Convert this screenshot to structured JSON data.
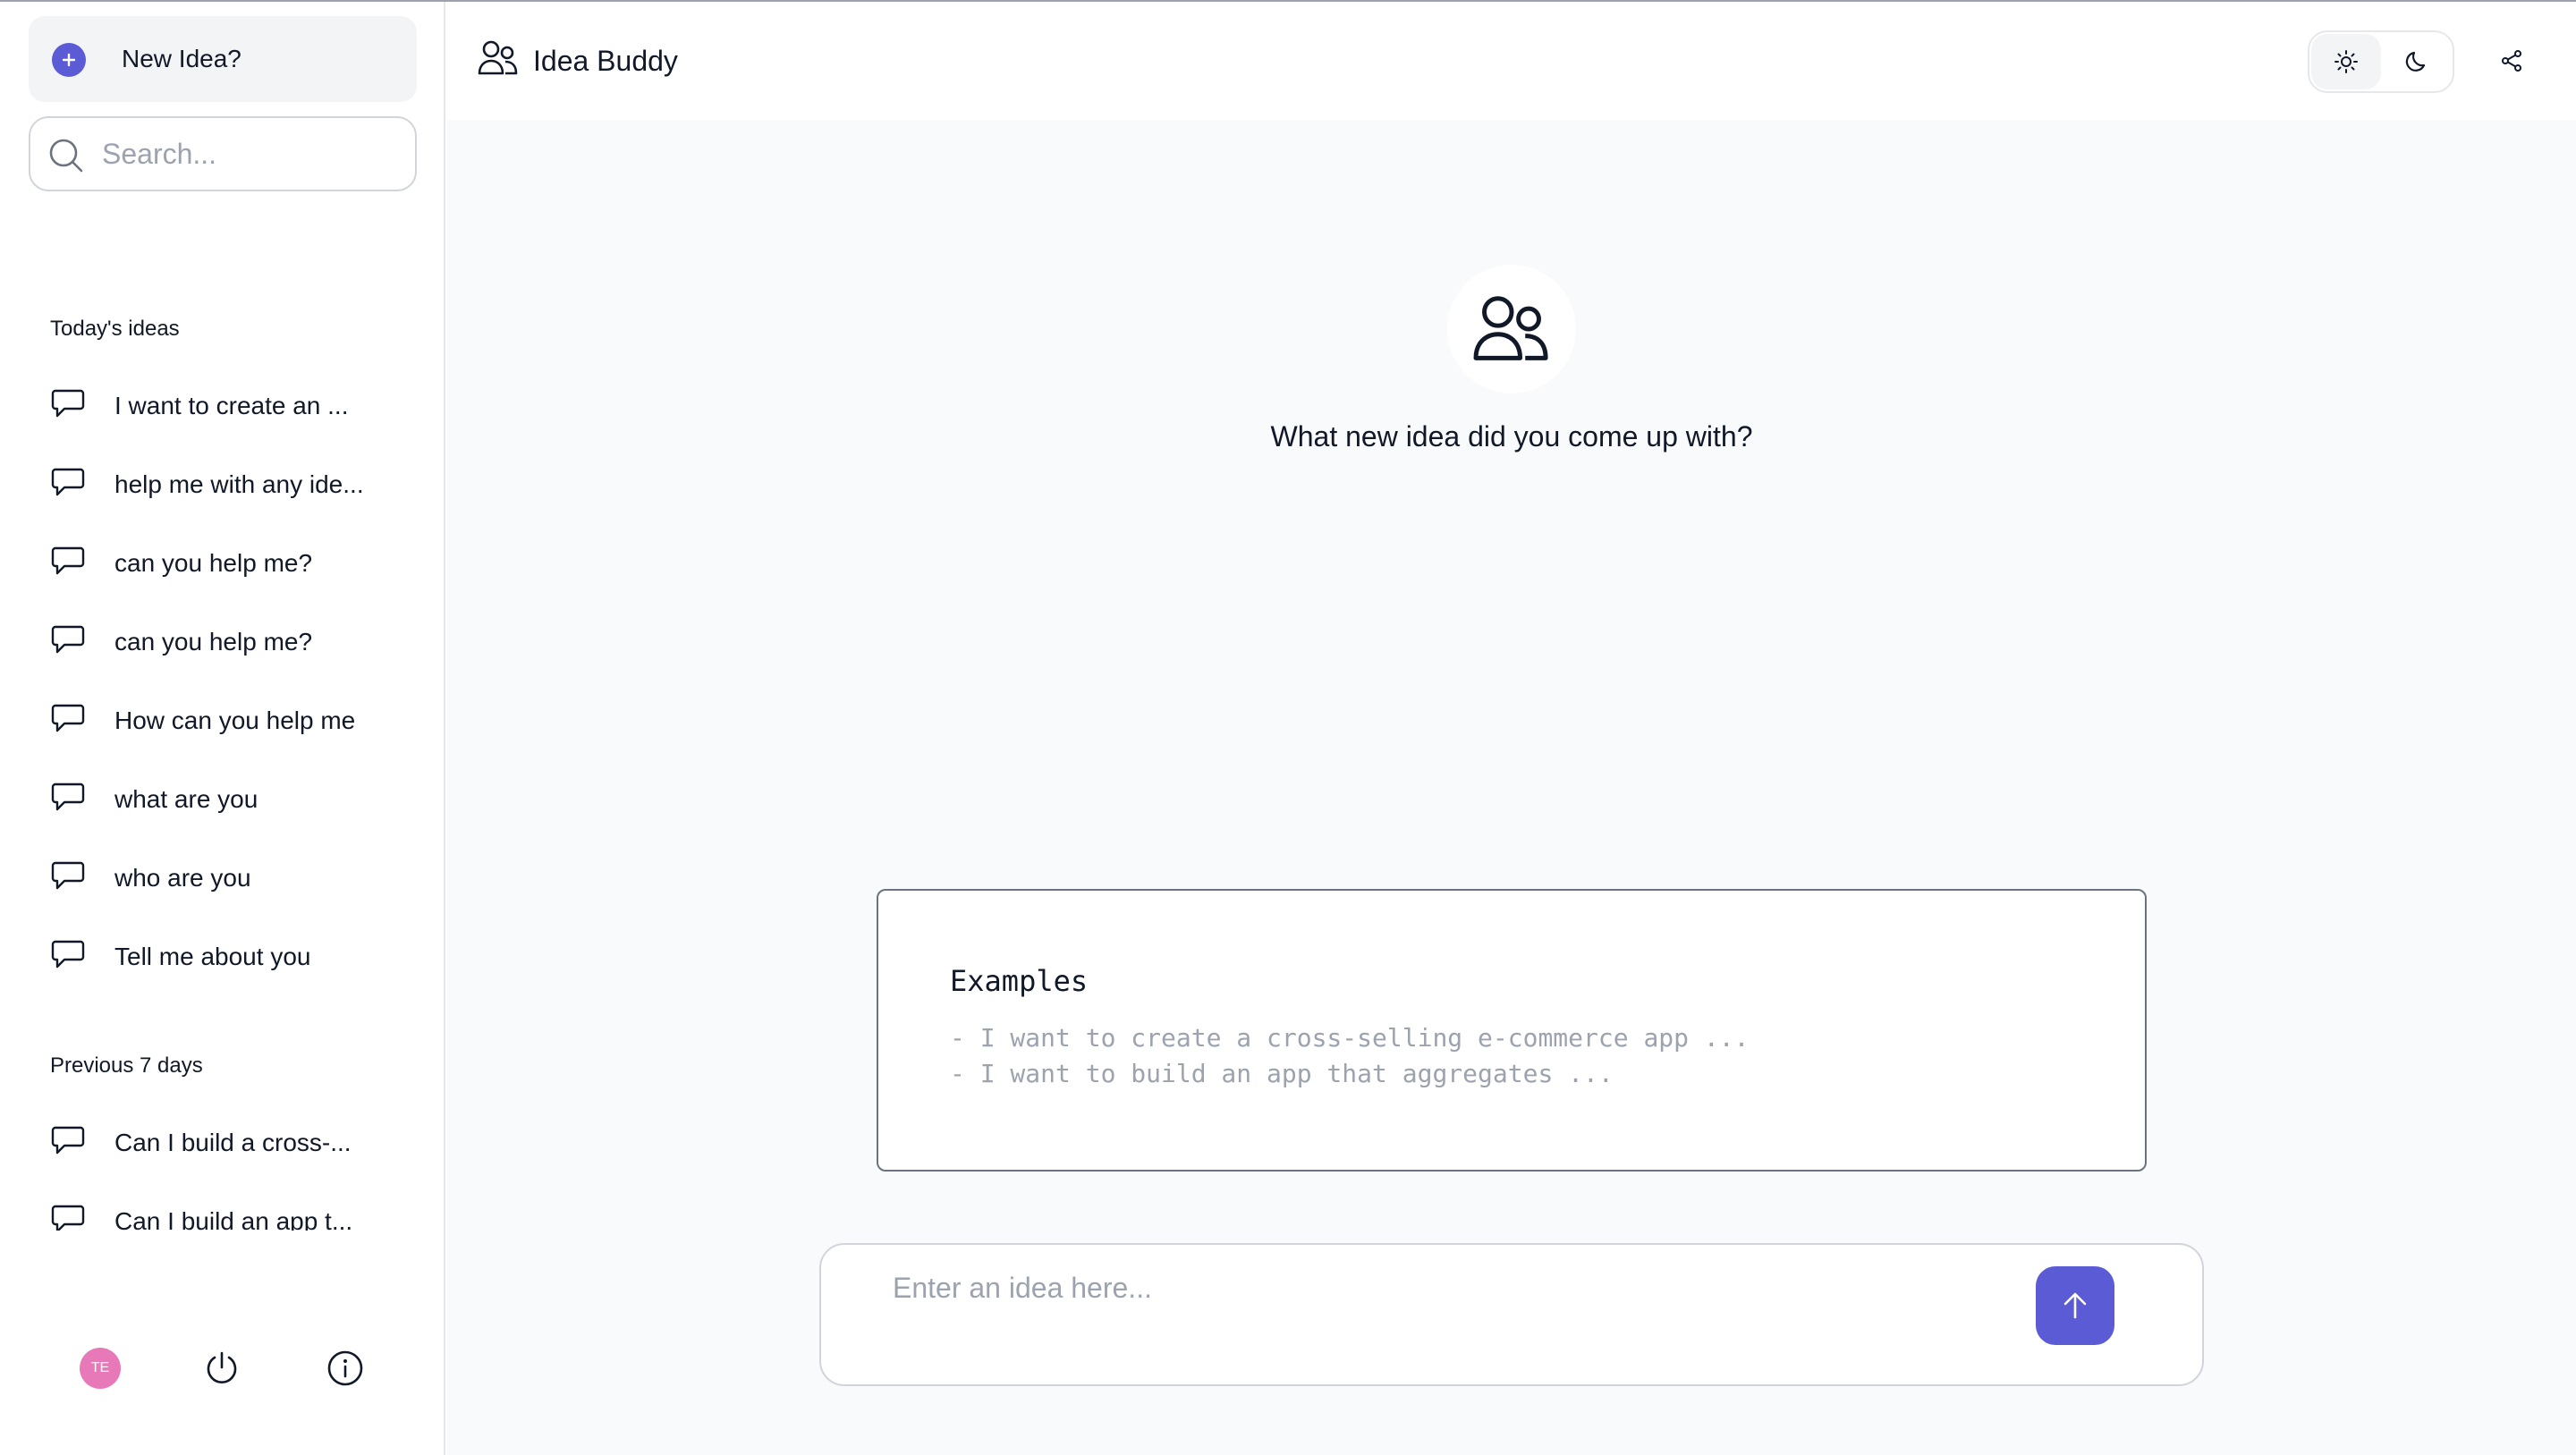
{
  "app": {
    "title": "Idea Buddy"
  },
  "sidebar": {
    "new_idea_label": "New Idea?",
    "search_placeholder": "Search...",
    "sections": [
      {
        "title": "Today's ideas",
        "items": [
          "I want to create an ...",
          "help me with any ide...",
          "can you help me?",
          "can you help me?",
          "How can you help me",
          "what are you",
          "who are you",
          "Tell me about you"
        ]
      },
      {
        "title": "Previous 7 days",
        "items": [
          "Can I build a cross-...",
          "Can I build an app t..."
        ]
      }
    ],
    "footer": {
      "avatar_initials": "TE"
    }
  },
  "main": {
    "question": "What new idea did you come up with?",
    "examples": {
      "title": "Examples",
      "lines": [
        "- I want to create a cross-selling e-commerce app ...",
        "- I want to build an app that aggregates ..."
      ]
    },
    "composer": {
      "placeholder": "Enter an idea here..."
    }
  },
  "colors": {
    "accent": "#5b5bd6",
    "avatar": "#e879b8",
    "main_bg": "#f9fafb"
  }
}
